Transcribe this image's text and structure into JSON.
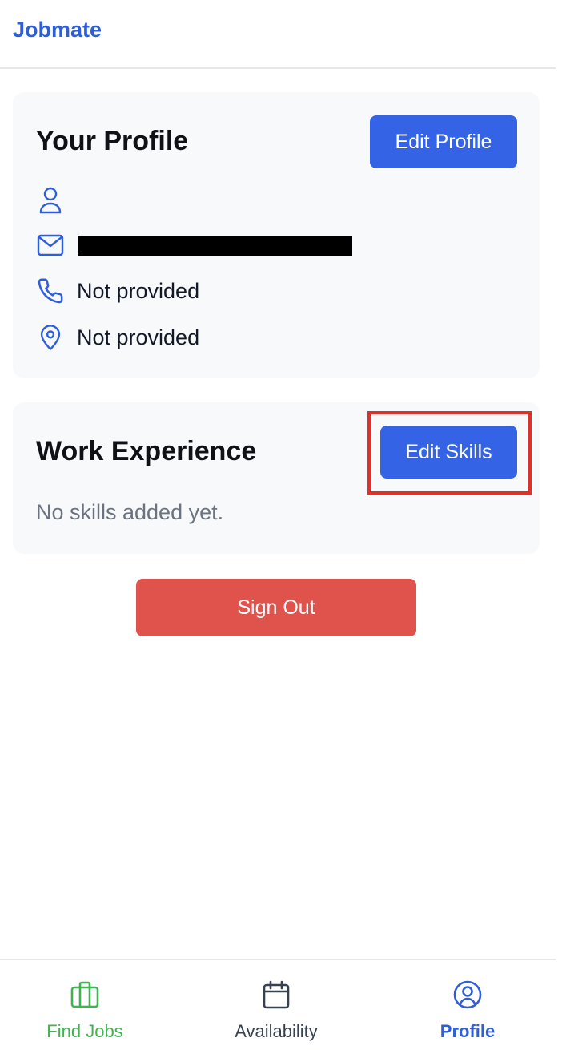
{
  "header": {
    "brand": "Jobmate"
  },
  "profile_card": {
    "title": "Your Profile",
    "edit_button": "Edit Profile",
    "name": "",
    "email": "",
    "phone": "Not provided",
    "location": "Not provided",
    "icons": [
      "user-icon",
      "mail-icon",
      "phone-icon",
      "location-pin-icon"
    ]
  },
  "work_card": {
    "title": "Work Experience",
    "edit_button": "Edit Skills",
    "empty_text": "No skills added yet."
  },
  "sign_out": {
    "label": "Sign Out"
  },
  "bottom_nav": {
    "items": [
      {
        "label": "Find Jobs",
        "icon": "briefcase-icon"
      },
      {
        "label": "Availability",
        "icon": "calendar-icon"
      },
      {
        "label": "Profile",
        "icon": "user-circle-icon",
        "active": true
      }
    ]
  },
  "colors": {
    "brand": "#2f5fd8",
    "primary_button": "#3563e6",
    "danger_button": "#e0524c",
    "find_jobs": "#3fb350",
    "highlight": "#e0302a"
  }
}
